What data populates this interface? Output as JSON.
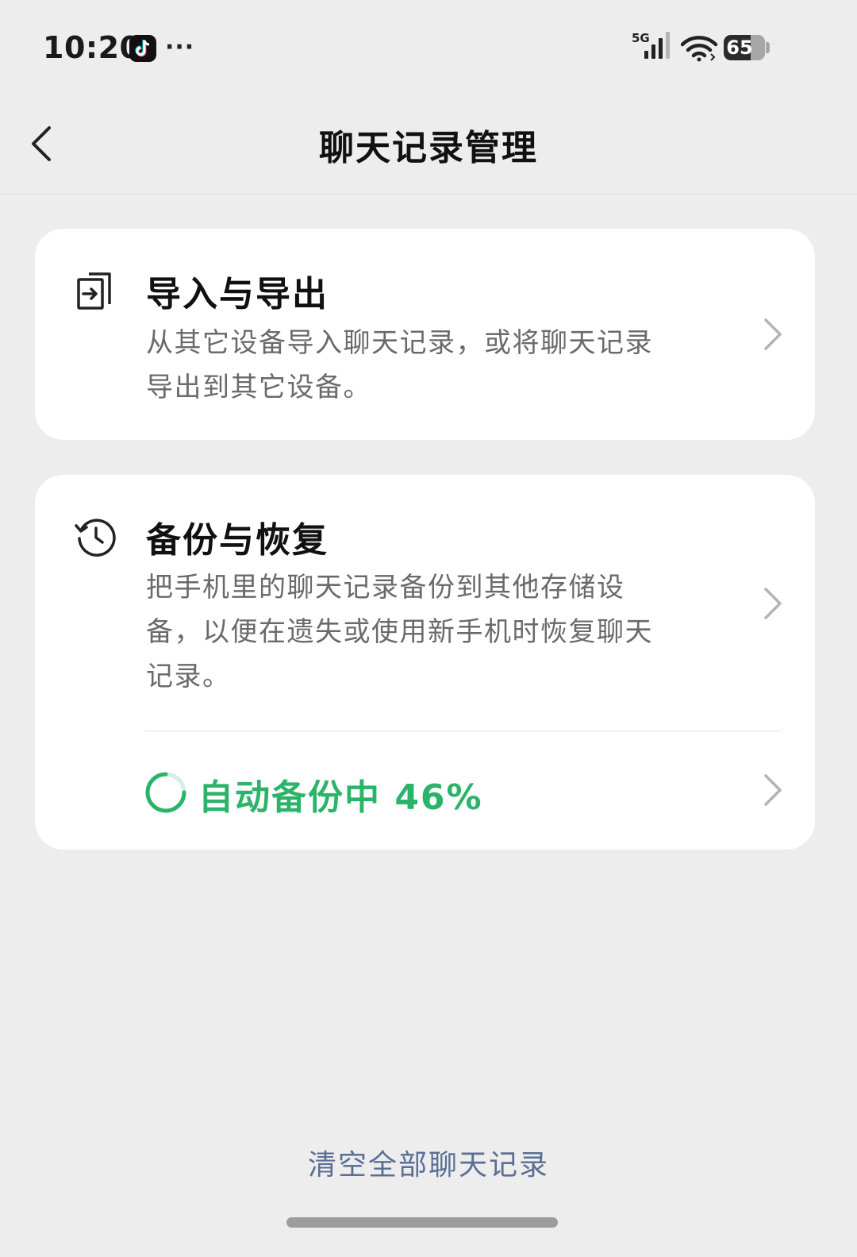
{
  "status_bar": {
    "time": "10:20",
    "more": "···",
    "network": "5G",
    "battery_level": 65,
    "battery_text": "65"
  },
  "nav": {
    "title": "聊天记录管理",
    "back_icon": "chevron-left-icon"
  },
  "sections": [
    {
      "icon": "import-export-icon",
      "title": "导入与导出",
      "description": "从其它设备导入聊天记录，或将聊天记录导出到其它设备。"
    },
    {
      "icon": "history-icon",
      "title": "备份与恢复",
      "description": "把手机里的聊天记录备份到其他存储设备，以便在遗失或使用新手机时恢复聊天记录。"
    }
  ],
  "auto_backup": {
    "label": "自动备份中 46%",
    "progress_percent": 46,
    "color": "#2bb36a"
  },
  "footer": {
    "clear_all": "清空全部聊天记录",
    "link_color": "#5b6f95"
  }
}
